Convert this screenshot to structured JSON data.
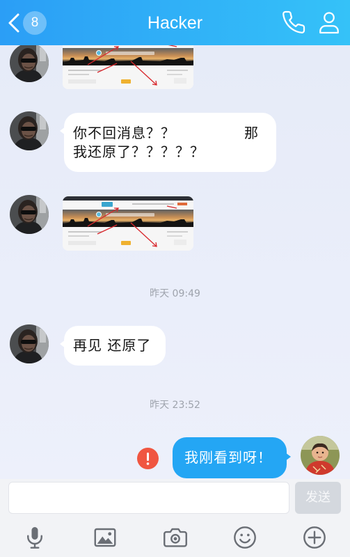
{
  "header": {
    "title": "Hacker",
    "unread_badge": "8",
    "icons": {
      "back": "chevron-left-icon",
      "call": "phone-icon",
      "profile": "person-icon"
    }
  },
  "chat": {
    "message_1": {
      "line_1_start": "你不回消息？？",
      "line_1_end": "那",
      "line_2": "我还原了？？？？？"
    },
    "timestamp_1": "昨天 09:49",
    "message_2": {
      "text": "再见 还原了"
    },
    "timestamp_2": "昨天 23:52",
    "message_3": {
      "text": "我刚看到呀！",
      "status_icon": "error-icon"
    }
  },
  "composer": {
    "input_value": "",
    "send_label": "发送"
  },
  "toolbar": {
    "icons": [
      "microphone-icon",
      "image-icon",
      "camera-icon",
      "emoji-icon",
      "plus-circle-icon"
    ]
  },
  "theme": {
    "header_start": "#2b9ef6",
    "header_end": "#35c2f8",
    "outgoing_bubble": "#24a6f4",
    "incoming_bubble": "#ffffff",
    "error": "#f05641",
    "timestamp": "#9ea3ac",
    "send_button": "#d4d8de",
    "toolbar_icon": "#6a6e75"
  }
}
